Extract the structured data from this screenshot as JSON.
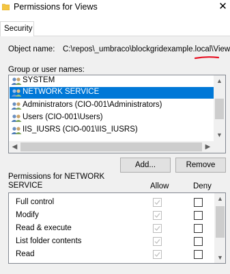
{
  "window": {
    "title": "Permissions for Views",
    "close_glyph": "✕"
  },
  "tabs": [
    {
      "label": "Security",
      "active": true
    }
  ],
  "object": {
    "label": "Object name:",
    "path": "C:\\repos\\_umbraco\\blockgridexample.local\\Views"
  },
  "groups": {
    "label": "Group or user names:",
    "items": [
      {
        "label": "SYSTEM",
        "icon": "users-icon",
        "selected": false
      },
      {
        "label": "NETWORK SERVICE",
        "icon": "users-icon",
        "selected": true
      },
      {
        "label": "Administrators (CIO-001\\Administrators)",
        "icon": "users-icon",
        "selected": false
      },
      {
        "label": "Users (CIO-001\\Users)",
        "icon": "users-icon",
        "selected": false
      },
      {
        "label": "IIS_IUSRS (CIO-001\\IIS_IUSRS)",
        "icon": "users-icon",
        "selected": false
      }
    ]
  },
  "buttons": {
    "add": "Add...",
    "remove": "Remove"
  },
  "permissions": {
    "label": "Permissions for NETWORK SERVICE",
    "allow_header": "Allow",
    "deny_header": "Deny",
    "items": [
      {
        "label": "Full control",
        "allow": true,
        "allow_disabled": true,
        "deny": false
      },
      {
        "label": "Modify",
        "allow": true,
        "allow_disabled": true,
        "deny": false
      },
      {
        "label": "Read & execute",
        "allow": true,
        "allow_disabled": true,
        "deny": false
      },
      {
        "label": "List folder contents",
        "allow": true,
        "allow_disabled": true,
        "deny": false
      },
      {
        "label": "Read",
        "allow": true,
        "allow_disabled": true,
        "deny": false
      }
    ]
  },
  "colors": {
    "selection": "#0078d7",
    "annotation_red": "#e81123",
    "folder": "#f4c542"
  }
}
